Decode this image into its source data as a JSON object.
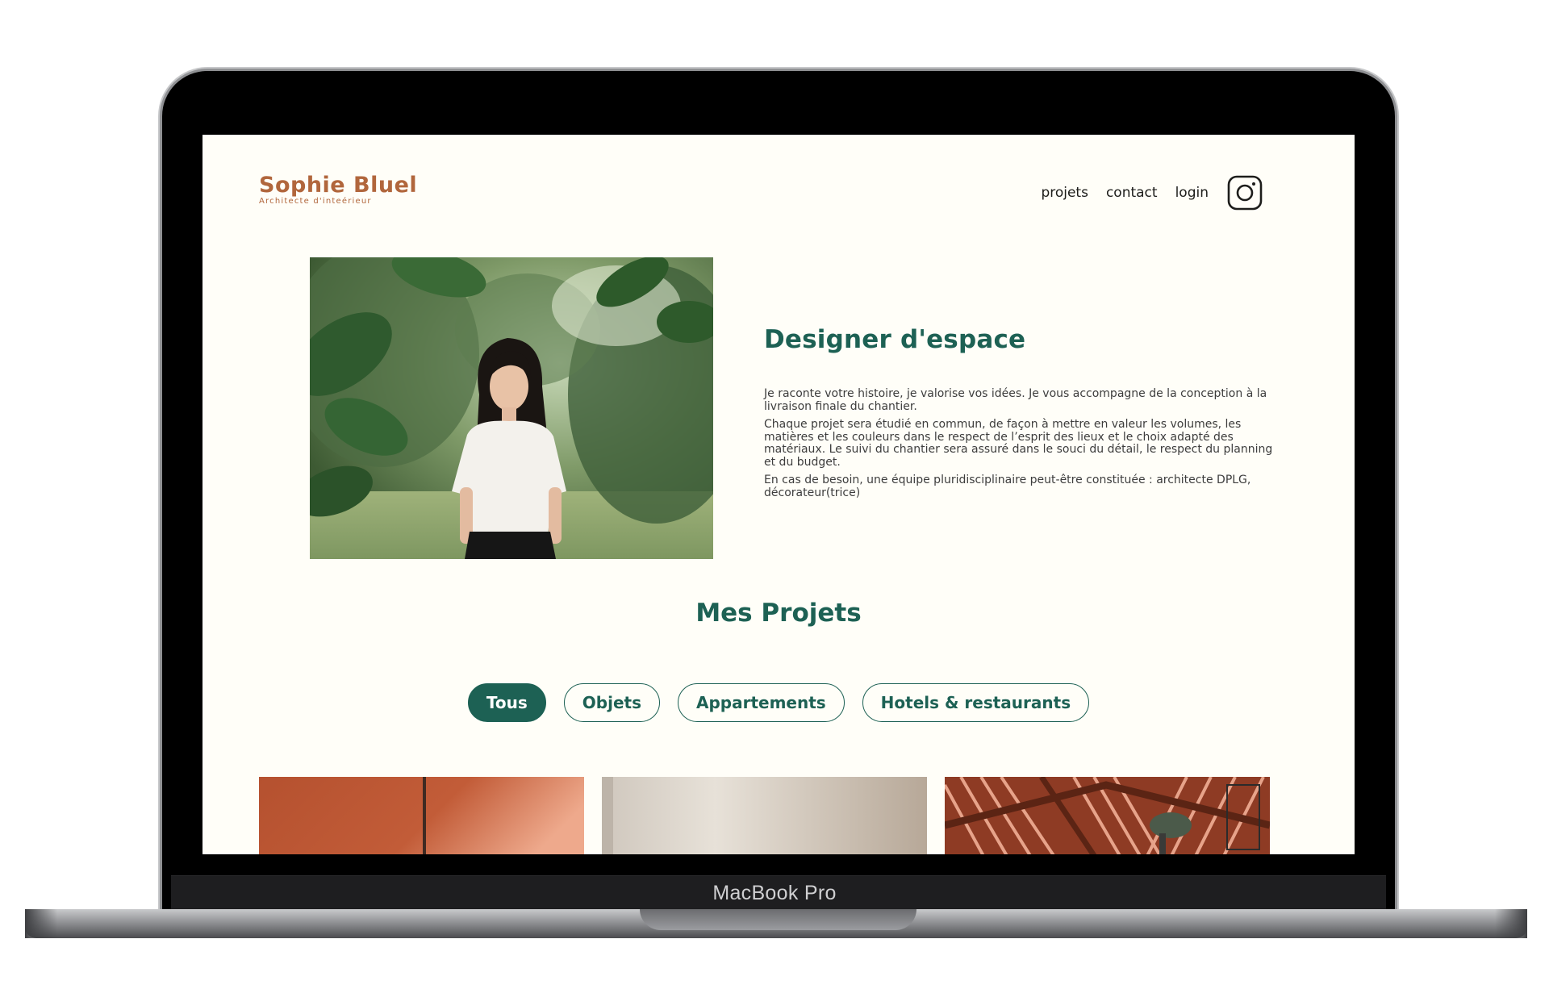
{
  "device": {
    "label": "MacBook Pro"
  },
  "header": {
    "logo_name": "Sophie Bluel",
    "logo_tagline": "Architecte d'inteérieur",
    "nav": [
      {
        "label": "projets"
      },
      {
        "label": "contact"
      },
      {
        "label": "login"
      }
    ]
  },
  "intro": {
    "title": "Designer d'espace",
    "paragraphs": [
      "Je raconte votre histoire, je valorise vos idées. Je vous accompagne de la conception à la livraison finale du chantier.",
      "Chaque projet sera étudié en commun, de façon à mettre en valeur les volumes, les matières et les couleurs dans le respect de l’esprit des lieux et le choix adapté des matériaux. Le suivi du chantier sera assuré dans le souci du détail, le respect du planning et du budget.",
      "En cas de besoin, une équipe pluridisciplinaire peut-être constituée : architecte DPLG, décorateur(trice)"
    ]
  },
  "projects": {
    "title": "Mes Projets",
    "filters": [
      {
        "label": "Tous",
        "active": true
      },
      {
        "label": "Objets",
        "active": false
      },
      {
        "label": "Appartements",
        "active": false
      },
      {
        "label": "Hotels & restaurants",
        "active": false
      }
    ]
  },
  "colors": {
    "accent": "#1d6154",
    "brand": "#b1663c",
    "page_bg": "#fffef8"
  },
  "icons": {
    "social": "instagram-icon"
  }
}
